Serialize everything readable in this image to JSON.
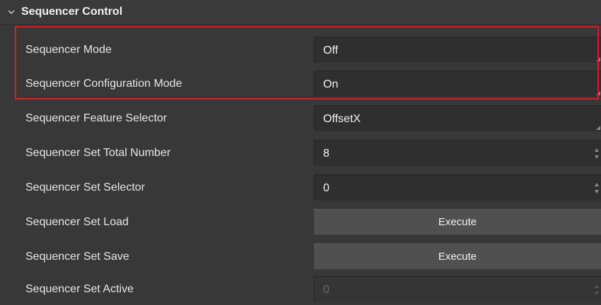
{
  "section": {
    "title": "Sequencer Control",
    "icon": "chevron-down-icon"
  },
  "highlight": {
    "color": "#d61f26",
    "rows": [
      "Sequencer Mode",
      "Sequencer Configuration Mode"
    ]
  },
  "rows": [
    {
      "label": "Sequencer Mode",
      "type": "combo",
      "value": "Off"
    },
    {
      "label": "Sequencer Configuration Mode",
      "type": "combo",
      "value": "On"
    },
    {
      "label": "Sequencer Feature Selector",
      "type": "combo",
      "value": "OffsetX"
    },
    {
      "label": "Sequencer Set Total Number",
      "type": "spin",
      "value": "8"
    },
    {
      "label": "Sequencer Set Selector",
      "type": "spin",
      "value": "0"
    },
    {
      "label": "Sequencer Set Load",
      "type": "button",
      "value": "Execute"
    },
    {
      "label": "Sequencer Set Save",
      "type": "button",
      "value": "Execute"
    },
    {
      "label": "Sequencer Set Active",
      "type": "spin-disabled",
      "value": "0"
    }
  ]
}
